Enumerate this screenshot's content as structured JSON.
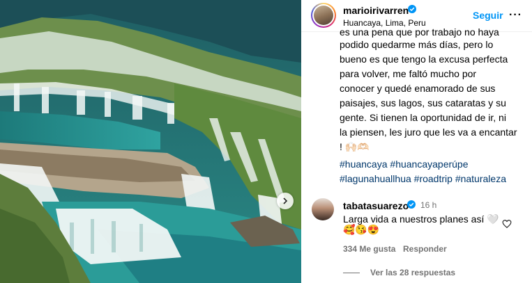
{
  "post": {
    "username": "marioirivarren",
    "location": "Huancaya, Lima, Peru",
    "follow_label": "Seguir",
    "more_label": "···"
  },
  "caption": {
    "clipped_line": "es una pena que por trabajo no haya",
    "lines": [
      "podido quedarme  más días, pero lo",
      "bueno es que tengo la excusa perfecta",
      "para volver, me faltó mucho por",
      "conocer y quedé enamorado de sus",
      "paisajes, sus lagos, sus cataratas y su",
      "gente. Si tienen la oportunidad de ir, ni",
      "la piensen, les juro que les va a encantar",
      "! 🙌🏻🫶🏻"
    ]
  },
  "hashtags": {
    "line1": [
      "#huancaya",
      "#huancayaperúpe"
    ],
    "line2": [
      "#lagunahuallhua",
      "#roadtrip",
      "#naturaleza"
    ]
  },
  "comment": {
    "username": "tabatasuarezo",
    "time": "16 h",
    "text": "Larga vida a nuestros planes así 🤍",
    "emojis": "🥰😘😍",
    "likes": "334 Me gusta",
    "reply_label": "Responder",
    "view_replies": "Ver las 28 respuestas"
  },
  "colors": {
    "link_blue": "#0095f6",
    "hashtag": "#00376b",
    "muted": "#737373",
    "verified": "#0095f6"
  },
  "icons": {
    "verified": "verified-badge-icon",
    "next": "chevron-right-icon",
    "heart": "heart-outline-icon"
  }
}
